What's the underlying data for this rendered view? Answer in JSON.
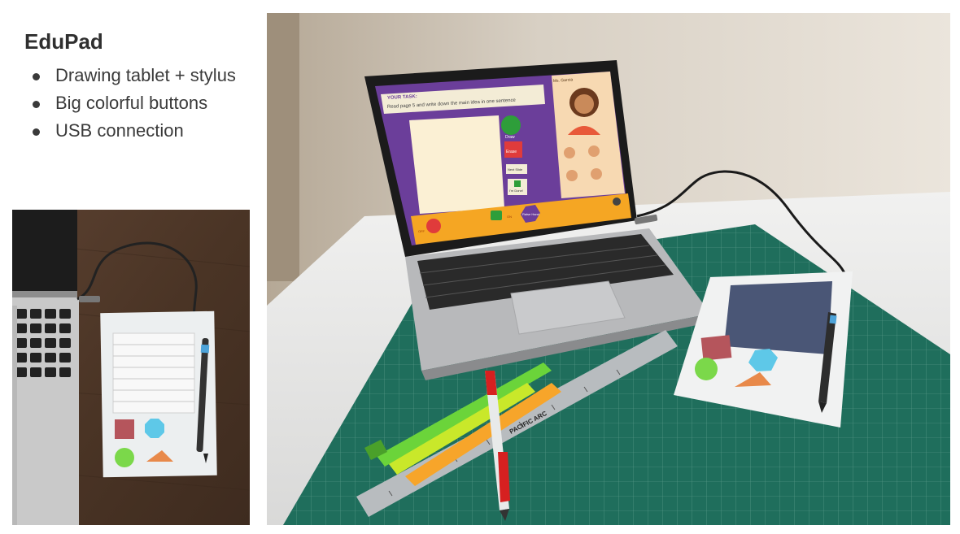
{
  "title": "EduPad",
  "bullets": [
    "Drawing tablet + stylus",
    "Big colorful buttons",
    "USB connection"
  ],
  "screen": {
    "task_label": "YOUR TASK:",
    "task_text": "Read page 5 and write down the main idea in one sentence",
    "teacher_name": "Ms. Garcia",
    "buttons": [
      "Draw",
      "Erase",
      "Next Slide",
      "I'm Done!"
    ],
    "raise_hand": "Raise Hand",
    "toggle_off": "OFF",
    "toggle_on": "ON"
  },
  "ruler_brand": "PACIFIC ARC",
  "colors": {
    "screen_purple": "#6b3e9a",
    "screen_orange": "#f5a623",
    "mat_green": "#1f6e5c",
    "button_red": "#b5555c",
    "button_blue": "#5ec8e8",
    "button_green": "#7bd84a",
    "button_orange": "#e8894a"
  },
  "icons": [
    "pencil-icon",
    "eraser-icon",
    "thumbs-up-icon",
    "mic-icon",
    "camera-icon",
    "settings-icon"
  ]
}
